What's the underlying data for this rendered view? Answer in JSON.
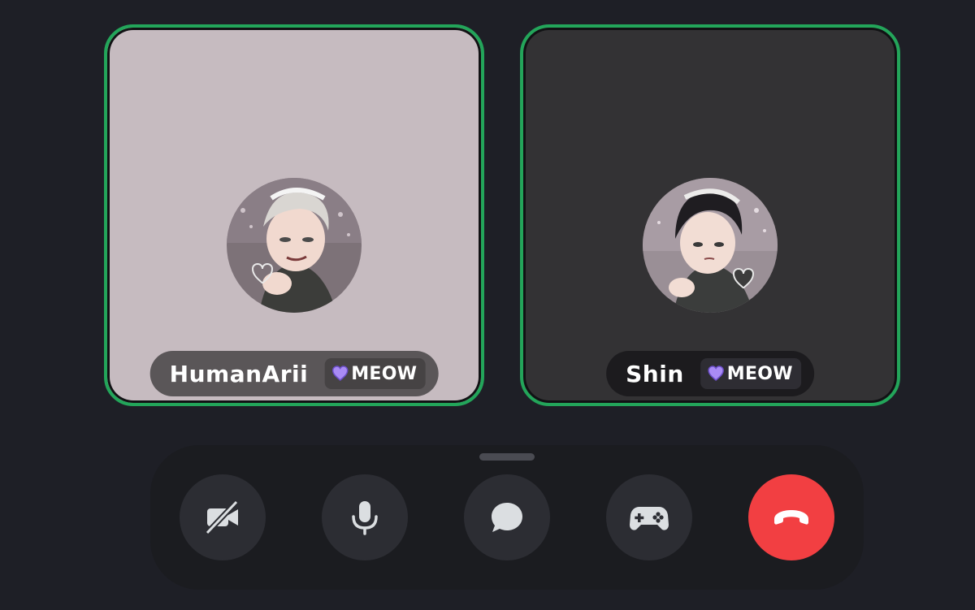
{
  "participants": [
    {
      "name": "HumanArii",
      "tag": "MEOW",
      "speaking": true,
      "tile_color": "#c6bbc0"
    },
    {
      "name": "Shin",
      "tag": "MEOW",
      "speaking": true,
      "tile_color": "#333234"
    }
  ],
  "colors": {
    "speaking_ring": "#23a55a",
    "end_call": "#f23f42",
    "control_bg": "#2c2d33",
    "tag_heart": "#a98bf5"
  },
  "controls": [
    {
      "id": "camera",
      "icon": "camera-off-icon",
      "state": "off"
    },
    {
      "id": "microphone",
      "icon": "microphone-icon",
      "state": "on"
    },
    {
      "id": "chat",
      "icon": "chat-bubble-icon"
    },
    {
      "id": "activities",
      "icon": "gamepad-icon"
    },
    {
      "id": "disconnect",
      "icon": "phone-hangup-icon"
    }
  ]
}
